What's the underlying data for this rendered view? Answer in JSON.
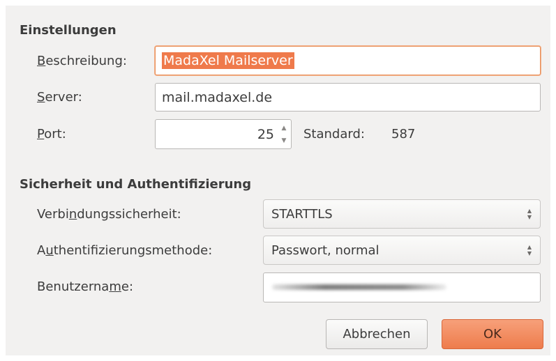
{
  "sections": {
    "settings_title": "Einstellungen",
    "security_title": "Sicherheit und Authentifizierung"
  },
  "fields": {
    "description": {
      "label_pre": "",
      "label_mnemonic": "B",
      "label_post": "eschreibung:",
      "value": "MadaXel Mailserver"
    },
    "server": {
      "label_pre": "",
      "label_mnemonic": "S",
      "label_post": "erver:",
      "value": "mail.madaxel.de"
    },
    "port": {
      "label_pre": "",
      "label_mnemonic": "P",
      "label_post": "ort:",
      "value": "25",
      "default_label": "Standard:",
      "default_value": "587"
    },
    "connection_security": {
      "label_pre": "Verbi",
      "label_mnemonic": "n",
      "label_post": "dungssicherheit:",
      "selected": "STARTTLS"
    },
    "auth_method": {
      "label_pre": "A",
      "label_mnemonic": "u",
      "label_post": "thentifizierungsmethode:",
      "selected": "Passwort, normal"
    },
    "username": {
      "label_pre": "Benutzerna",
      "label_mnemonic": "m",
      "label_post": "e:",
      "value": ""
    }
  },
  "buttons": {
    "cancel": "Abbrechen",
    "ok": "OK"
  },
  "icons": {
    "spin_up": "▲",
    "spin_down": "▼",
    "select_up": "▲",
    "select_down": "▼"
  },
  "colors": {
    "accent": "#ef7a4b",
    "dialog_background": "#f2f1f0"
  }
}
